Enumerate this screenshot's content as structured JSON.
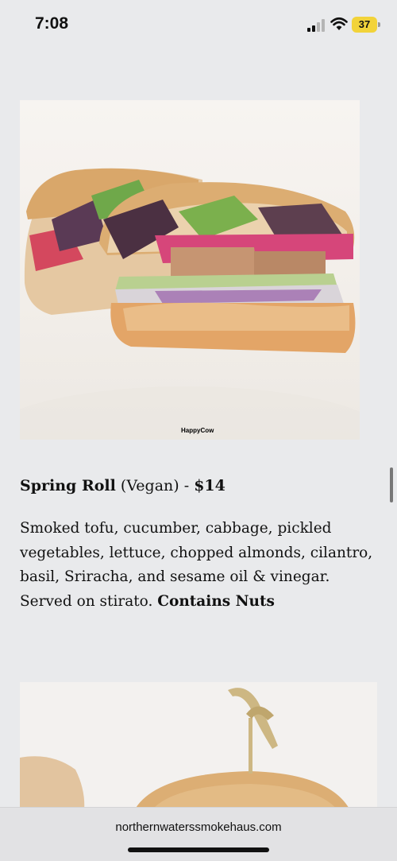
{
  "status_bar": {
    "time": "7:08",
    "battery": "37",
    "icons": [
      "cellular-signal-icon",
      "wifi-icon",
      "battery-icon"
    ]
  },
  "item": {
    "name": "Spring Roll",
    "diet": "(Vegan)",
    "sep": " - ",
    "price": "$14",
    "description": "Smoked tofu, cucumber, cabbage, pickled vegetables, lettuce, chopped almonds, cilantro, basil, Sriracha, and sesame oil & vinegar. Served on stirato. ",
    "allergen": "Contains Nuts",
    "photo_watermark": "HappyCow"
  },
  "browser": {
    "url": "northernwaterssmokehaus.com"
  }
}
